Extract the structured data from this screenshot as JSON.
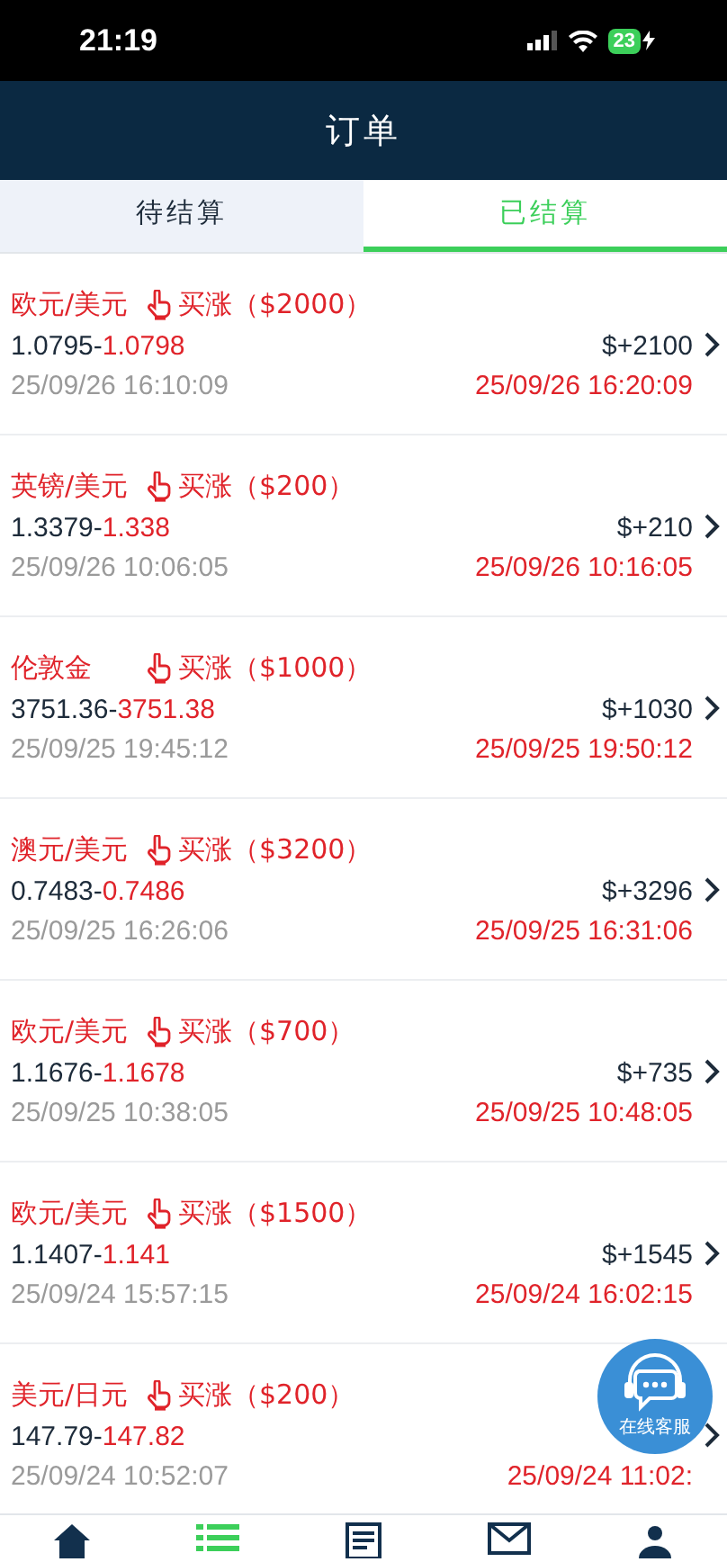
{
  "status_bar": {
    "time": "21:19",
    "battery": "23"
  },
  "header": {
    "title": "订单"
  },
  "tabs": [
    {
      "label": "待结算",
      "selected": false
    },
    {
      "label": "已结算",
      "selected": true
    }
  ],
  "orders": [
    {
      "pair": "欧元/美元",
      "direction": "买涨（$2000）",
      "open_price": "1.0795-",
      "close_price": "1.0798",
      "profit": "$+2100",
      "open_time": "25/09/26 16:10:09",
      "close_time": "25/09/26 16:20:09"
    },
    {
      "pair": "英镑/美元",
      "direction": "买涨（$200）",
      "open_price": "1.3379-",
      "close_price": "1.338",
      "profit": "$+210",
      "open_time": "25/09/26 10:06:05",
      "close_time": "25/09/26 10:16:05"
    },
    {
      "pair": "伦敦金",
      "direction": "买涨（$1000）",
      "open_price": "3751.36-",
      "close_price": "3751.38",
      "profit": "$+1030",
      "open_time": "25/09/25 19:45:12",
      "close_time": "25/09/25 19:50:12"
    },
    {
      "pair": "澳元/美元",
      "direction": "买涨（$3200）",
      "open_price": "0.7483-",
      "close_price": "0.7486",
      "profit": "$+3296",
      "open_time": "25/09/25 16:26:06",
      "close_time": "25/09/25 16:31:06"
    },
    {
      "pair": "欧元/美元",
      "direction": "买涨（$700）",
      "open_price": "1.1676-",
      "close_price": "1.1678",
      "profit": "$+735",
      "open_time": "25/09/25 10:38:05",
      "close_time": "25/09/25 10:48:05"
    },
    {
      "pair": "欧元/美元",
      "direction": "买涨（$1500）",
      "open_price": "1.1407-",
      "close_price": "1.141",
      "profit": "$+1545",
      "open_time": "25/09/24 15:57:15",
      "close_time": "25/09/24 16:02:15"
    },
    {
      "pair": "美元/日元",
      "direction": "买涨（$200）",
      "open_price": "147.79-",
      "close_price": "147.82",
      "open_time": "25/09/24 10:52:07",
      "close_time": "25/09/24 11:02:"
    }
  ],
  "support_bubble": {
    "label": "在线客服"
  },
  "nav": [
    {
      "kind": "home",
      "selected": false
    },
    {
      "kind": "list",
      "selected": true
    },
    {
      "kind": "document",
      "selected": false
    },
    {
      "kind": "mail",
      "selected": false
    },
    {
      "kind": "person",
      "selected": false
    }
  ]
}
